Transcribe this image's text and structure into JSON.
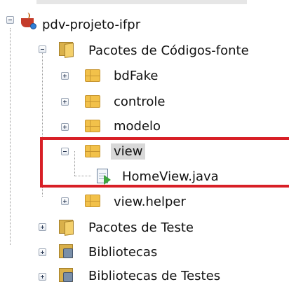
{
  "tree": {
    "project": "pdv-projeto-ifpr",
    "source_packages": "Pacotes de Códigos-fonte",
    "packages": [
      "bdFake",
      "controle",
      "modelo",
      "view"
    ],
    "view_file": "HomeView.java",
    "view_helper": "view.helper",
    "test_packages": "Pacotes de Teste",
    "libraries": "Bibliotecas",
    "test_libraries": "Bibliotecas de Testes"
  },
  "colors": {
    "highlight": "#d81f26",
    "package": "#f2c14a"
  }
}
